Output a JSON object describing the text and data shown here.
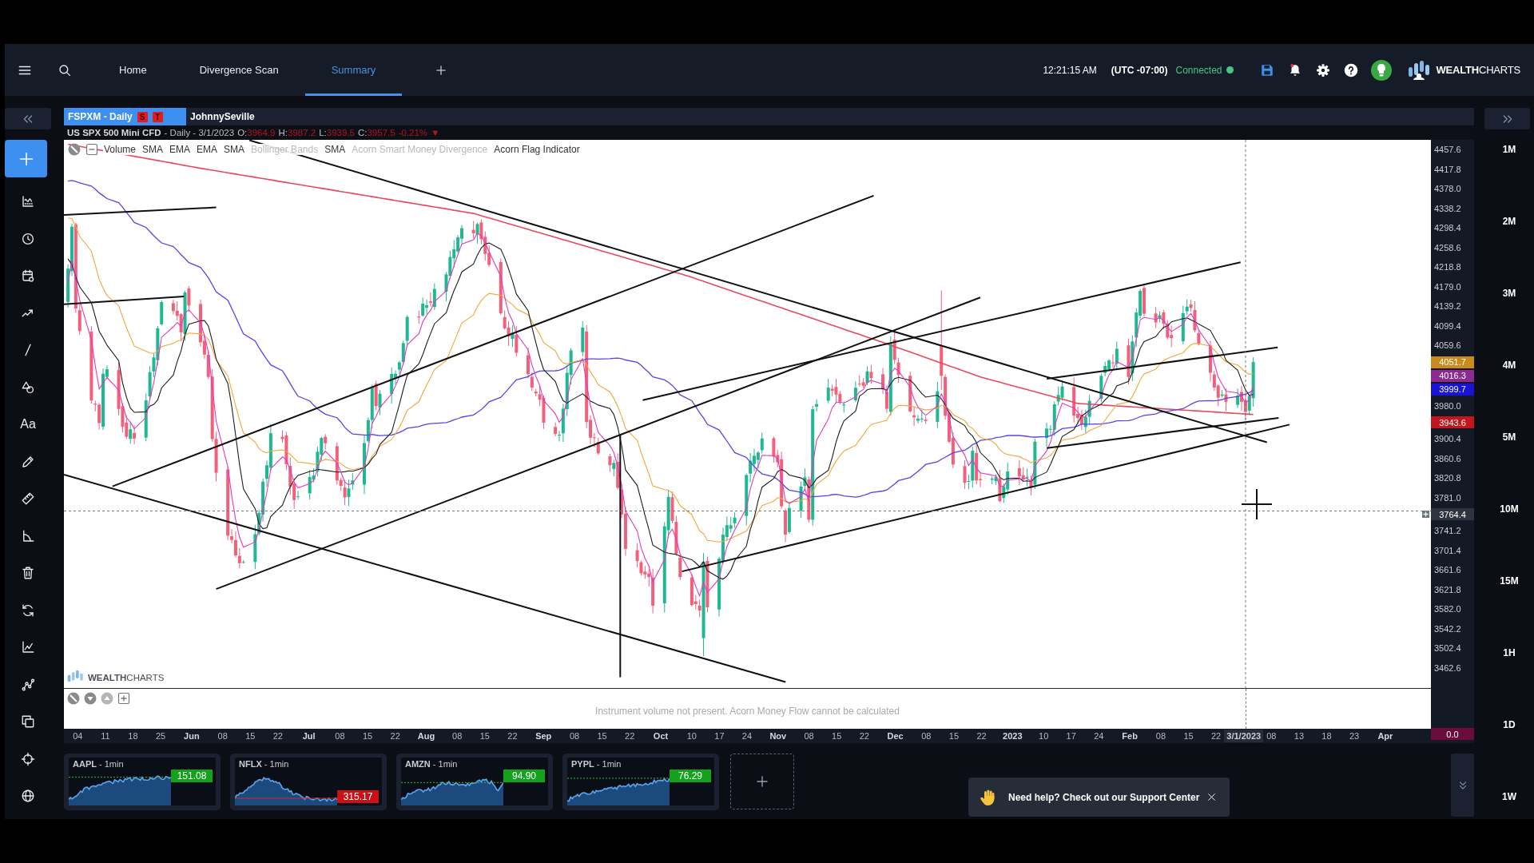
{
  "top_bar": {
    "tabs": [
      {
        "label": "Home",
        "selected": false
      },
      {
        "label": "Divergence Scan",
        "selected": false
      },
      {
        "label": "Summary",
        "selected": true
      }
    ],
    "time": "12:21:15 AM",
    "timezone": "(UTC -07:00)",
    "connection": {
      "label": "Connected",
      "connected": true
    },
    "notifications": {
      "unread": true
    },
    "brand": "**WEALTH**CHARTS"
  },
  "sidebar": {
    "text_tool": "Aa"
  },
  "chart_tabs": [
    {
      "label": "FSPXM - Daily",
      "selected": true,
      "flags": [
        "S",
        "T"
      ]
    },
    {
      "label": "JohnnySeville",
      "selected": false
    }
  ],
  "quote": {
    "symbol": "US SPX 500 Mini CFD",
    "details": "- Daily - 3/1/2023",
    "ohlc": [
      {
        "label": "O:",
        "value": "3964.9"
      },
      {
        "label": "H:",
        "value": "3987.2"
      },
      {
        "label": "L:",
        "value": "3939.5"
      },
      {
        "label": "C:",
        "value": "3957.5"
      }
    ],
    "change": "-0.21%",
    "arrow": "▼",
    "falling": true
  },
  "indicators": [
    {
      "label": "Volume",
      "dimmed": false
    },
    {
      "label": "SMA",
      "dimmed": false
    },
    {
      "label": "EMA",
      "dimmed": false
    },
    {
      "label": "EMA",
      "dimmed": false
    },
    {
      "label": "SMA",
      "dimmed": false
    },
    {
      "label": "Bollinger Bands",
      "dimmed": true
    },
    {
      "label": "SMA",
      "dimmed": false
    },
    {
      "label": "Acorn Smart Money Divergence",
      "dimmed": true
    },
    {
      "label": "Acorn Flag Indicator",
      "dimmed": false
    }
  ],
  "chart": {
    "watermark": "**WEALTH**CHARTS",
    "price_axis": [
      {
        "kind": "tick",
        "label": "4457.6"
      },
      {
        "kind": "tick",
        "label": "4417.8"
      },
      {
        "kind": "tick",
        "label": "4378.0"
      },
      {
        "kind": "tick",
        "label": "4338.2"
      },
      {
        "kind": "tick",
        "label": "4298.4"
      },
      {
        "kind": "tick",
        "label": "4258.6"
      },
      {
        "kind": "tick",
        "label": "4218.8"
      },
      {
        "kind": "tick",
        "label": "4179.0"
      },
      {
        "kind": "tick",
        "label": "4139.2"
      },
      {
        "kind": "tick",
        "label": "4099.4"
      },
      {
        "kind": "tick",
        "label": "4059.6"
      },
      {
        "kind": "badge",
        "label": "4051.7",
        "color": "#c98b1f"
      },
      {
        "kind": "badge",
        "label": "4016.3",
        "color": "#8b2a93"
      },
      {
        "kind": "badge",
        "label": "3999.7",
        "color": "#1a12d6"
      },
      {
        "kind": "tick",
        "label": "3980.0"
      },
      {
        "kind": "badge",
        "label": "3943.6",
        "color": "#c3151d"
      },
      {
        "kind": "tick",
        "label": "3900.4"
      },
      {
        "kind": "tick",
        "label": "3860.6"
      },
      {
        "kind": "tick",
        "label": "3820.8"
      },
      {
        "kind": "tick",
        "label": "3781.0"
      },
      {
        "kind": "cursor",
        "label": "3764.4",
        "color": "#2e333d"
      },
      {
        "kind": "tick",
        "label": "3741.2"
      },
      {
        "kind": "tick",
        "label": "3701.4"
      },
      {
        "kind": "tick",
        "label": "3661.6"
      },
      {
        "kind": "tick",
        "label": "3621.8"
      },
      {
        "kind": "tick",
        "label": "3582.0"
      },
      {
        "kind": "tick",
        "label": "3542.2"
      },
      {
        "kind": "tick",
        "label": "3502.4"
      },
      {
        "kind": "tick",
        "label": "3462.6"
      }
    ],
    "volume_badge": {
      "label": "0.0",
      "color": "#6b0d3c"
    },
    "date_axis": [
      {
        "kind": "day",
        "label": "04"
      },
      {
        "kind": "day",
        "label": "11"
      },
      {
        "kind": "day",
        "label": "18"
      },
      {
        "kind": "day",
        "label": "25"
      },
      {
        "kind": "month",
        "label": "Jun"
      },
      {
        "kind": "day",
        "label": "08"
      },
      {
        "kind": "day",
        "label": "15"
      },
      {
        "kind": "day",
        "label": "22"
      },
      {
        "kind": "month",
        "label": "Jul"
      },
      {
        "kind": "day",
        "label": "08"
      },
      {
        "kind": "day",
        "label": "15"
      },
      {
        "kind": "day",
        "label": "22"
      },
      {
        "kind": "month",
        "label": "Aug"
      },
      {
        "kind": "day",
        "label": "08"
      },
      {
        "kind": "day",
        "label": "15"
      },
      {
        "kind": "day",
        "label": "22"
      },
      {
        "kind": "month",
        "label": "Sep"
      },
      {
        "kind": "day",
        "label": "08"
      },
      {
        "kind": "day",
        "label": "15"
      },
      {
        "kind": "day",
        "label": "22"
      },
      {
        "kind": "month",
        "label": "Oct"
      },
      {
        "kind": "day",
        "label": "10"
      },
      {
        "kind": "day",
        "label": "17"
      },
      {
        "kind": "day",
        "label": "24"
      },
      {
        "kind": "month",
        "label": "Nov"
      },
      {
        "kind": "day",
        "label": "08"
      },
      {
        "kind": "day",
        "label": "15"
      },
      {
        "kind": "day",
        "label": "22"
      },
      {
        "kind": "month",
        "label": "Dec"
      },
      {
        "kind": "day",
        "label": "08"
      },
      {
        "kind": "day",
        "label": "15"
      },
      {
        "kind": "day",
        "label": "22"
      },
      {
        "kind": "month",
        "label": "2023"
      },
      {
        "kind": "day",
        "label": "10"
      },
      {
        "kind": "day",
        "label": "17"
      },
      {
        "kind": "day",
        "label": "24"
      },
      {
        "kind": "month",
        "label": "Feb"
      },
      {
        "kind": "day",
        "label": "08"
      },
      {
        "kind": "day",
        "label": "15"
      },
      {
        "kind": "day",
        "label": "22"
      },
      {
        "kind": "cursor",
        "label": "3/1/2023"
      },
      {
        "kind": "day",
        "label": "08"
      },
      {
        "kind": "day",
        "label": "13"
      },
      {
        "kind": "day",
        "label": "18"
      },
      {
        "kind": "day",
        "label": "23"
      },
      {
        "kind": "month",
        "label": "Apr"
      }
    ]
  },
  "indicator_pane": {
    "message": "Instrument volume not present. Acorn Money Flow cannot be calculated"
  },
  "timeframes": [
    "1M",
    "2M",
    "3M",
    "4M",
    "5M",
    "10M",
    "15M",
    "1H",
    "1D",
    "1W"
  ],
  "mini_charts": [
    {
      "title": "**AAPL** - 1min",
      "price": "151.08",
      "rising": true
    },
    {
      "title": "**NFLX** - 1min",
      "price": "315.17",
      "rising": false
    },
    {
      "title": "**AMZN** - 1min",
      "price": "94.90",
      "rising": true
    },
    {
      "title": "**PYPL** - 1min",
      "price": "76.29",
      "rising": true
    }
  ],
  "help_toast": {
    "text": "Need help? Check out our Support Center"
  }
}
